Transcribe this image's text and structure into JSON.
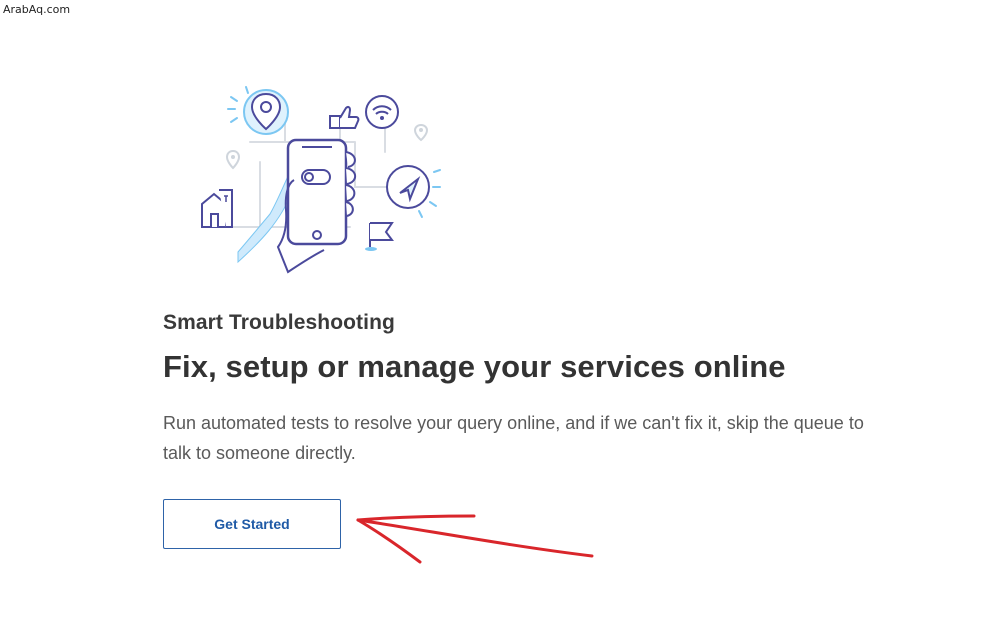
{
  "watermark": "ArabAq.com",
  "hero": {
    "illustration": "smart-troubleshooting-phone-illustration"
  },
  "content": {
    "eyebrow": "Smart Troubleshooting",
    "headline": "Fix, setup or manage your services online",
    "description": "Run automated tests to resolve your query online, and if we can't fix it, skip the queue to talk to someone directly."
  },
  "actions": {
    "get_started_label": "Get Started"
  },
  "colors": {
    "primary": "#2e63a8",
    "illustration_stroke": "#4b4a9c",
    "illustration_accent": "#7cc7f2",
    "annotation": "#d9262b"
  }
}
